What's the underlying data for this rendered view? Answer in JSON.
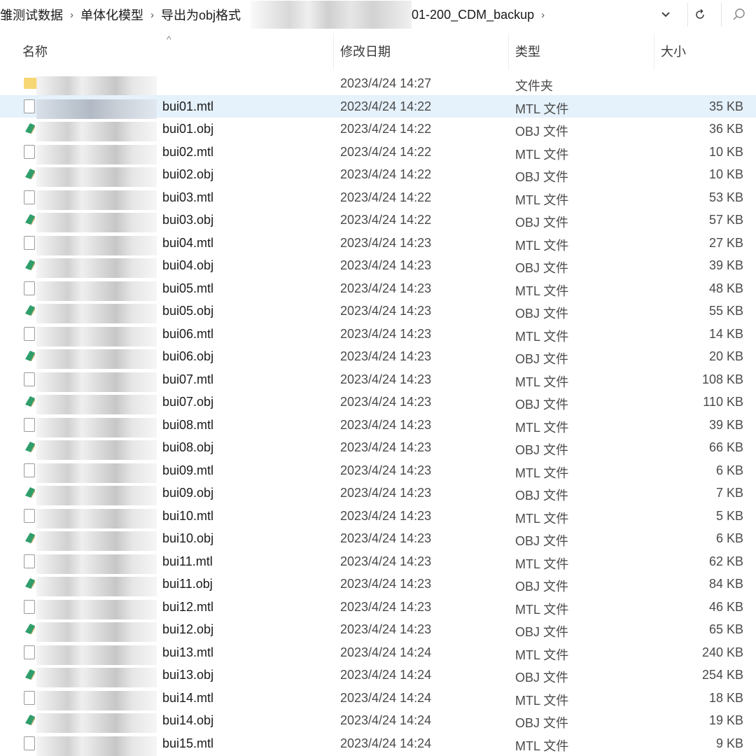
{
  "address_bar": {
    "crumbs": [
      "雏测试数据",
      "单体化模型",
      "导出为obj格式",
      "01-200_CDM_backup"
    ],
    "separator": "›",
    "dropdown_icon": "chevron-down-icon",
    "refresh_icon": "refresh-icon",
    "search_icon": "search-icon"
  },
  "columns": {
    "name": "名称",
    "date": "修改日期",
    "type": "类型",
    "size": "大小"
  },
  "files": [
    {
      "name": "",
      "date": "2023/4/24 14:27",
      "type": "文件夹",
      "size": "",
      "icon": "folder-icon"
    },
    {
      "name": "bui01.mtl",
      "date": "2023/4/24 14:22",
      "type": "MTL 文件",
      "size": "35 KB",
      "icon": "mtl-file-icon",
      "selected": true
    },
    {
      "name": "bui01.obj",
      "date": "2023/4/24 14:22",
      "type": "OBJ 文件",
      "size": "36 KB",
      "icon": "obj-file-icon"
    },
    {
      "name": "bui02.mtl",
      "date": "2023/4/24 14:22",
      "type": "MTL 文件",
      "size": "10 KB",
      "icon": "mtl-file-icon"
    },
    {
      "name": "bui02.obj",
      "date": "2023/4/24 14:22",
      "type": "OBJ 文件",
      "size": "10 KB",
      "icon": "obj-file-icon"
    },
    {
      "name": "bui03.mtl",
      "date": "2023/4/24 14:22",
      "type": "MTL 文件",
      "size": "53 KB",
      "icon": "mtl-file-icon"
    },
    {
      "name": "bui03.obj",
      "date": "2023/4/24 14:22",
      "type": "OBJ 文件",
      "size": "57 KB",
      "icon": "obj-file-icon"
    },
    {
      "name": "bui04.mtl",
      "date": "2023/4/24 14:23",
      "type": "MTL 文件",
      "size": "27 KB",
      "icon": "mtl-file-icon"
    },
    {
      "name": "bui04.obj",
      "date": "2023/4/24 14:23",
      "type": "OBJ 文件",
      "size": "39 KB",
      "icon": "obj-file-icon"
    },
    {
      "name": "bui05.mtl",
      "date": "2023/4/24 14:23",
      "type": "MTL 文件",
      "size": "48 KB",
      "icon": "mtl-file-icon"
    },
    {
      "name": "bui05.obj",
      "date": "2023/4/24 14:23",
      "type": "OBJ 文件",
      "size": "55 KB",
      "icon": "obj-file-icon"
    },
    {
      "name": "bui06.mtl",
      "date": "2023/4/24 14:23",
      "type": "MTL 文件",
      "size": "14 KB",
      "icon": "mtl-file-icon"
    },
    {
      "name": "bui06.obj",
      "date": "2023/4/24 14:23",
      "type": "OBJ 文件",
      "size": "20 KB",
      "icon": "obj-file-icon"
    },
    {
      "name": "bui07.mtl",
      "date": "2023/4/24 14:23",
      "type": "MTL 文件",
      "size": "108 KB",
      "icon": "mtl-file-icon"
    },
    {
      "name": "bui07.obj",
      "date": "2023/4/24 14:23",
      "type": "OBJ 文件",
      "size": "110 KB",
      "icon": "obj-file-icon"
    },
    {
      "name": "bui08.mtl",
      "date": "2023/4/24 14:23",
      "type": "MTL 文件",
      "size": "39 KB",
      "icon": "mtl-file-icon"
    },
    {
      "name": "bui08.obj",
      "date": "2023/4/24 14:23",
      "type": "OBJ 文件",
      "size": "66 KB",
      "icon": "obj-file-icon"
    },
    {
      "name": "bui09.mtl",
      "date": "2023/4/24 14:23",
      "type": "MTL 文件",
      "size": "6 KB",
      "icon": "mtl-file-icon"
    },
    {
      "name": "bui09.obj",
      "date": "2023/4/24 14:23",
      "type": "OBJ 文件",
      "size": "7 KB",
      "icon": "obj-file-icon"
    },
    {
      "name": "bui10.mtl",
      "date": "2023/4/24 14:23",
      "type": "MTL 文件",
      "size": "5 KB",
      "icon": "mtl-file-icon"
    },
    {
      "name": "bui10.obj",
      "date": "2023/4/24 14:23",
      "type": "OBJ 文件",
      "size": "6 KB",
      "icon": "obj-file-icon"
    },
    {
      "name": "bui11.mtl",
      "date": "2023/4/24 14:23",
      "type": "MTL 文件",
      "size": "62 KB",
      "icon": "mtl-file-icon"
    },
    {
      "name": "bui11.obj",
      "date": "2023/4/24 14:23",
      "type": "OBJ 文件",
      "size": "84 KB",
      "icon": "obj-file-icon"
    },
    {
      "name": "bui12.mtl",
      "date": "2023/4/24 14:23",
      "type": "MTL 文件",
      "size": "46 KB",
      "icon": "mtl-file-icon"
    },
    {
      "name": "bui12.obj",
      "date": "2023/4/24 14:23",
      "type": "OBJ 文件",
      "size": "65 KB",
      "icon": "obj-file-icon"
    },
    {
      "name": "bui13.mtl",
      "date": "2023/4/24 14:24",
      "type": "MTL 文件",
      "size": "240 KB",
      "icon": "mtl-file-icon"
    },
    {
      "name": "bui13.obj",
      "date": "2023/4/24 14:24",
      "type": "OBJ 文件",
      "size": "254 KB",
      "icon": "obj-file-icon"
    },
    {
      "name": "bui14.mtl",
      "date": "2023/4/24 14:24",
      "type": "MTL 文件",
      "size": "18 KB",
      "icon": "mtl-file-icon"
    },
    {
      "name": "bui14.obj",
      "date": "2023/4/24 14:24",
      "type": "OBJ 文件",
      "size": "19 KB",
      "icon": "obj-file-icon"
    },
    {
      "name": "bui15.mtl",
      "date": "2023/4/24 14:24",
      "type": "MTL 文件",
      "size": "9 KB",
      "icon": "mtl-file-icon"
    }
  ],
  "colors": {
    "selection": "#e5f1fb",
    "folder": "#f7d774",
    "obj_icon": "#2f9e6b"
  }
}
